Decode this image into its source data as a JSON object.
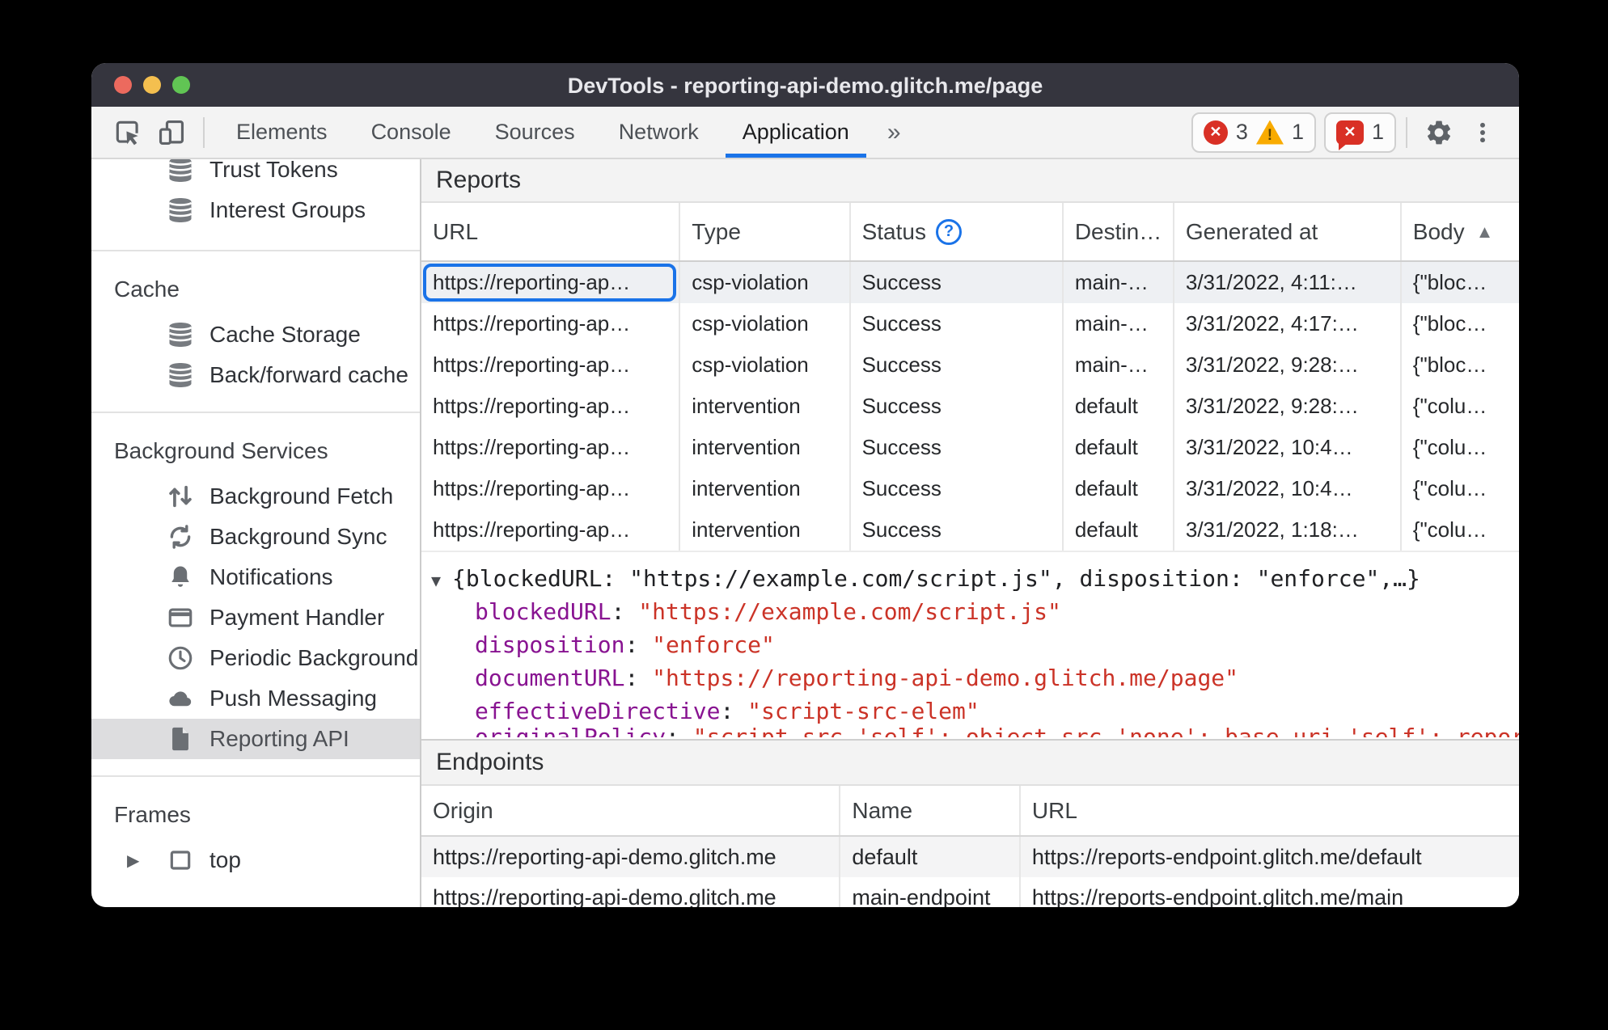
{
  "window": {
    "title": "DevTools - reporting-api-demo.glitch.me/page"
  },
  "toolbar": {
    "tabs": [
      {
        "label": "Elements"
      },
      {
        "label": "Console"
      },
      {
        "label": "Sources"
      },
      {
        "label": "Network"
      },
      {
        "label": "Application",
        "active": true
      }
    ],
    "more_tabs_label": "»",
    "error_count": "3",
    "warning_count": "1",
    "issue_count": "1",
    "error_glyph": "✕",
    "warning_glyph": "!",
    "issue_glyph": "✕"
  },
  "sidebar": {
    "top_items": [
      {
        "label": "Trust Tokens",
        "icon": "database"
      },
      {
        "label": "Interest Groups",
        "icon": "database"
      }
    ],
    "sections": [
      {
        "title": "Cache",
        "items": [
          {
            "label": "Cache Storage",
            "icon": "database"
          },
          {
            "label": "Back/forward cache",
            "icon": "database"
          }
        ]
      },
      {
        "title": "Background Services",
        "items": [
          {
            "label": "Background Fetch",
            "icon": "fetch-arrows"
          },
          {
            "label": "Background Sync",
            "icon": "sync"
          },
          {
            "label": "Notifications",
            "icon": "bell"
          },
          {
            "label": "Payment Handler",
            "icon": "payment-card"
          },
          {
            "label": "Periodic Background",
            "icon": "clock"
          },
          {
            "label": "Push Messaging",
            "icon": "cloud"
          },
          {
            "label": "Reporting API",
            "icon": "file",
            "selected": true
          }
        ]
      },
      {
        "title": "Frames",
        "items": [
          {
            "label": "top",
            "icon": "frame"
          }
        ]
      }
    ],
    "frame_expander_glyph": "▶"
  },
  "reports": {
    "title": "Reports",
    "columns": [
      "URL",
      "Type",
      "Status",
      "Destin…",
      "Generated at",
      "Body"
    ],
    "help_glyph": "?",
    "sort_glyph": "▲",
    "rows": [
      {
        "url": "https://reporting-ap…",
        "type": "csp-violation",
        "status": "Success",
        "destination": "main-…",
        "generated": "3/31/2022, 4:11:…",
        "body": "{\"bloc…",
        "selected": true
      },
      {
        "url": "https://reporting-ap…",
        "type": "csp-violation",
        "status": "Success",
        "destination": "main-…",
        "generated": "3/31/2022, 4:17:…",
        "body": "{\"bloc…"
      },
      {
        "url": "https://reporting-ap…",
        "type": "csp-violation",
        "status": "Success",
        "destination": "main-…",
        "generated": "3/31/2022, 9:28:…",
        "body": "{\"bloc…"
      },
      {
        "url": "https://reporting-ap…",
        "type": "intervention",
        "status": "Success",
        "destination": "default",
        "generated": "3/31/2022, 9:28:…",
        "body": "{\"colu…"
      },
      {
        "url": "https://reporting-ap…",
        "type": "intervention",
        "status": "Success",
        "destination": "default",
        "generated": "3/31/2022, 10:4…",
        "body": "{\"colu…"
      },
      {
        "url": "https://reporting-ap…",
        "type": "intervention",
        "status": "Success",
        "destination": "default",
        "generated": "3/31/2022, 10:4…",
        "body": "{\"colu…"
      },
      {
        "url": "https://reporting-ap…",
        "type": "intervention",
        "status": "Success",
        "destination": "default",
        "generated": "3/31/2022, 1:18:…",
        "body": "{\"colu…"
      }
    ]
  },
  "preview": {
    "expander_glyph": "▼",
    "summary": "{blockedURL: \"https://example.com/script.js\", disposition: \"enforce\",…}",
    "separator": ": ",
    "fields": [
      {
        "key": "blockedURL",
        "value": "\"https://example.com/script.js\""
      },
      {
        "key": "disposition",
        "value": "\"enforce\""
      },
      {
        "key": "documentURL",
        "value": "\"https://reporting-api-demo.glitch.me/page\""
      },
      {
        "key": "effectiveDirective",
        "value": "\"script-src-elem\""
      }
    ],
    "clipped_field": {
      "key": "originalPolicy",
      "value": "\"script-src 'self'; object-src 'none'; base-uri 'self'; report-to main-endpoint\""
    }
  },
  "endpoints": {
    "title": "Endpoints",
    "columns": [
      "Origin",
      "Name",
      "URL"
    ],
    "rows": [
      {
        "origin": "https://reporting-api-demo.glitch.me",
        "name": "default",
        "url": "https://reports-endpoint.glitch.me/default"
      },
      {
        "origin": "https://reporting-api-demo.glitch.me",
        "name": "main-endpoint",
        "url": "https://reports-endpoint.glitch.me/main"
      }
    ]
  },
  "colors": {
    "accent_blue": "#1a73e8",
    "error_red": "#d93025",
    "warning_yellow": "#f9ab00",
    "key_purple": "#881391",
    "string_red": "#cb3327",
    "titlebar": "#35353e"
  }
}
